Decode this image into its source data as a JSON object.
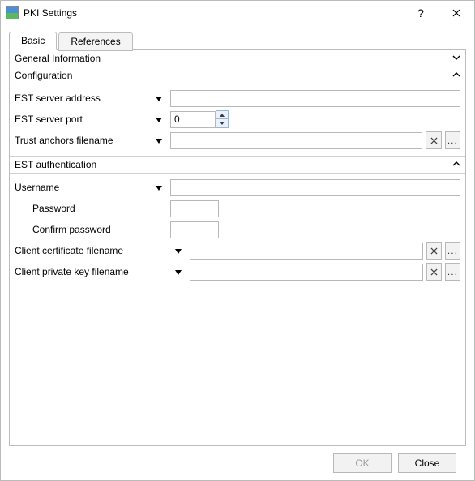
{
  "window": {
    "title": "PKI Settings",
    "help_tooltip": "?",
    "close_tooltip": "Close"
  },
  "tabs": {
    "basic": "Basic",
    "references": "References"
  },
  "sections": {
    "general_info": {
      "title": "General Information",
      "expanded": false
    },
    "configuration": {
      "title": "Configuration",
      "expanded": true,
      "est_server_address": {
        "label": "EST server address",
        "value": ""
      },
      "est_server_port": {
        "label": "EST server port",
        "value": "0"
      },
      "trust_anchors_filename": {
        "label": "Trust anchors filename",
        "value": ""
      }
    },
    "est_auth": {
      "title": "EST authentication",
      "expanded": true,
      "username": {
        "label": "Username",
        "value": ""
      },
      "password": {
        "label": "Password",
        "value": ""
      },
      "confirm_password": {
        "label": "Confirm password",
        "value": ""
      },
      "client_cert_filename": {
        "label": "Client certificate filename",
        "value": ""
      },
      "client_priv_key_filename": {
        "label": "Client private key filename",
        "value": ""
      }
    }
  },
  "buttons": {
    "ok": "OK",
    "close": "Close",
    "clear_tooltip": "Clear",
    "browse_tooltip": "Browse"
  }
}
